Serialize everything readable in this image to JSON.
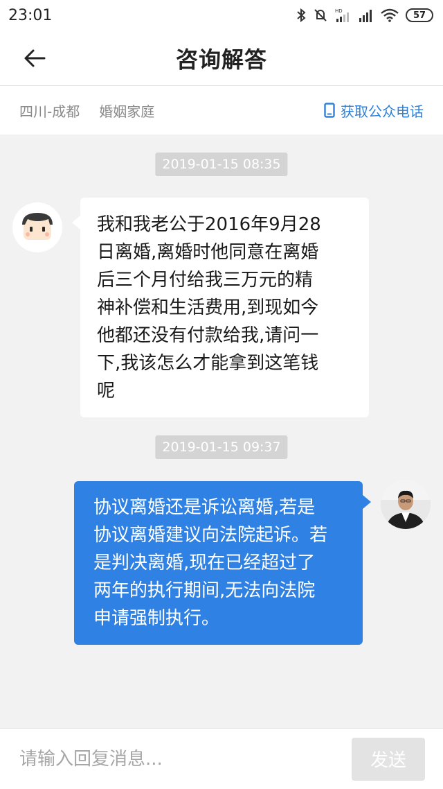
{
  "status_bar": {
    "time": "23:01",
    "battery": "57",
    "icons": [
      "bluetooth-icon",
      "mute-icon",
      "hd-signal-icon",
      "signal-icon",
      "wifi-icon",
      "battery-icon"
    ]
  },
  "header": {
    "title": "咨询解答",
    "back_icon": "back-arrow-icon"
  },
  "info_bar": {
    "region": "四川-成都",
    "category": "婚姻家庭",
    "get_phone_label": "获取公众电话",
    "accent_color": "#2f80d6"
  },
  "chat": {
    "messages": [
      {
        "timestamp": "2019-01-15 08:35",
        "side": "left",
        "lines": [
          "我和我老公于2016年9月28",
          "日离婚,离婚时他同意在离婚",
          "后三个月付给我三万元的精",
          "神补偿和生活费用,到现如今",
          "他都还没有付款给我,请问一",
          "下,我该怎么才能拿到这笔钱",
          "呢"
        ]
      },
      {
        "timestamp": "2019-01-15 09:37",
        "side": "right",
        "lines": [
          "协议离婚还是诉讼离婚,若是",
          "协议离婚建议向法院起诉。若",
          "是判决离婚,现在已经超过了",
          "两年的执行期间,无法向法院",
          "申请强制执行。"
        ],
        "bubble_color": "#2f82e4"
      }
    ]
  },
  "input_bar": {
    "placeholder": "请输入回复消息...",
    "send_label": "发送"
  }
}
